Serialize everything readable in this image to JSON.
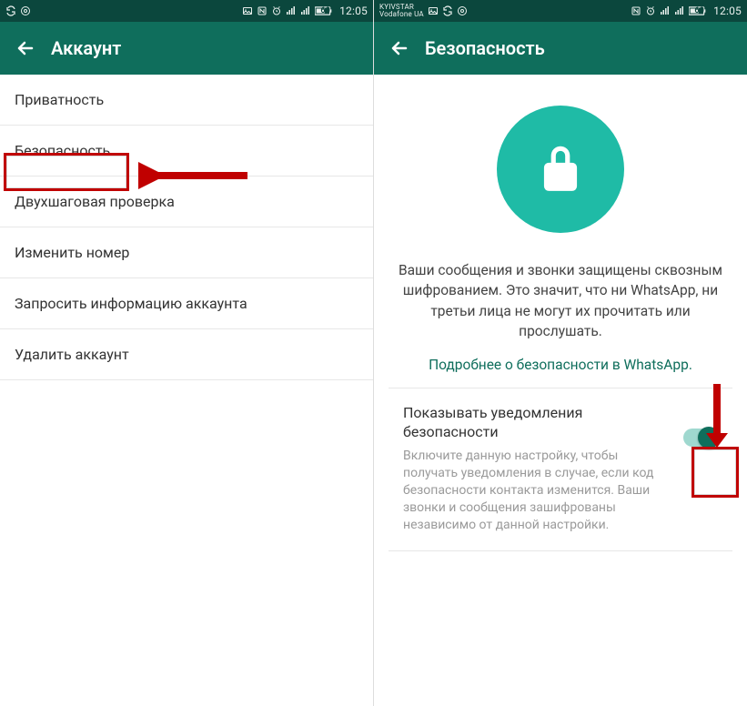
{
  "statusbar_left": {
    "carrier": "",
    "time": "12:05",
    "battery": "60"
  },
  "statusbar_right": {
    "carrier_line1": "KYIVSTAR",
    "carrier_line2": "Vodafone UA",
    "time": "12:05",
    "battery": "60"
  },
  "left": {
    "title": "Аккаунт",
    "items": [
      "Приватность",
      "Безопасность",
      "Двухшаговая проверка",
      "Изменить номер",
      "Запросить информацию аккаунта",
      "Удалить аккаунт"
    ]
  },
  "right": {
    "title": "Безопасность",
    "desc": "Ваши сообщения и звонки защищены сквозным шифрованием. Это значит, что ни WhatsApp, ни третьи лица не могут их прочитать или прослушать.",
    "link": "Подробнее о безопасности в WhatsApp.",
    "setting_title": "Показывать уведомления безопасности",
    "setting_sub": "Включите данную настройку, чтобы получать уведомления в случае, если код безопасности контакта изменится. Ваши звонки и сообщения зашифрованы независимо от данной настройки."
  }
}
